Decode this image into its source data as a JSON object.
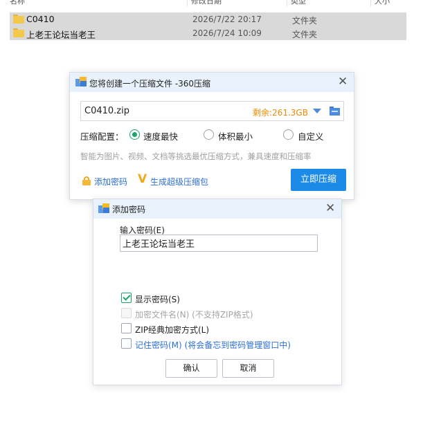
{
  "explorer": {
    "columns": [
      "名称",
      "修改日期",
      "类型",
      "大小"
    ],
    "rows": [
      {
        "name": "C0410",
        "date": "2026/7/22 20:17",
        "type": "文件夹"
      },
      {
        "name": "上老王论坛当老王",
        "date": "2026/7/24 10:09",
        "type": "文件夹"
      }
    ]
  },
  "compress_dialog": {
    "title": "您将创建一个压缩文件 -360压缩",
    "filename": "C0410.zip",
    "free_space": "剩余:261.3GB",
    "config_label": "压缩配置：",
    "options": [
      "速度最快",
      "体积最小",
      "自定义"
    ],
    "selected_option": "速度最快",
    "hint": "智能为图片、视频、文档等挑选最优压缩方式，兼具速度和压缩率",
    "add_password": "添加密码",
    "super_package": "生成超级压缩包",
    "compress_button": "立即压缩"
  },
  "password_dialog": {
    "title": "添加密码",
    "input_label": "输入密码(E)",
    "password_value": "上老王论坛当老王",
    "checkboxes": [
      {
        "label": "显示密码(S)",
        "checked": true,
        "disabled": false
      },
      {
        "label": "加密文件名(N) (不支持ZIP格式)",
        "checked": false,
        "disabled": true
      },
      {
        "label": "ZIP经典加密方式(L)",
        "checked": false,
        "disabled": false
      },
      {
        "label": "记住密码(M) (将会备忘到密码管理窗口中)",
        "checked": false,
        "disabled": false
      }
    ],
    "ok_button": "确认",
    "cancel_button": "取消"
  },
  "colors": {
    "accent_blue": "#1c8be8",
    "title_bar": "#e9f2fc",
    "radio_green": "#1aa36b",
    "free_space_orange": "#f08a00",
    "link_blue": "#2c6fd6"
  },
  "icons": [
    "folder-icon",
    "app-360-icon",
    "close-icon",
    "dropdown-arrow-icon",
    "browse-folder-icon",
    "lock-icon",
    "v-super-icon"
  ]
}
